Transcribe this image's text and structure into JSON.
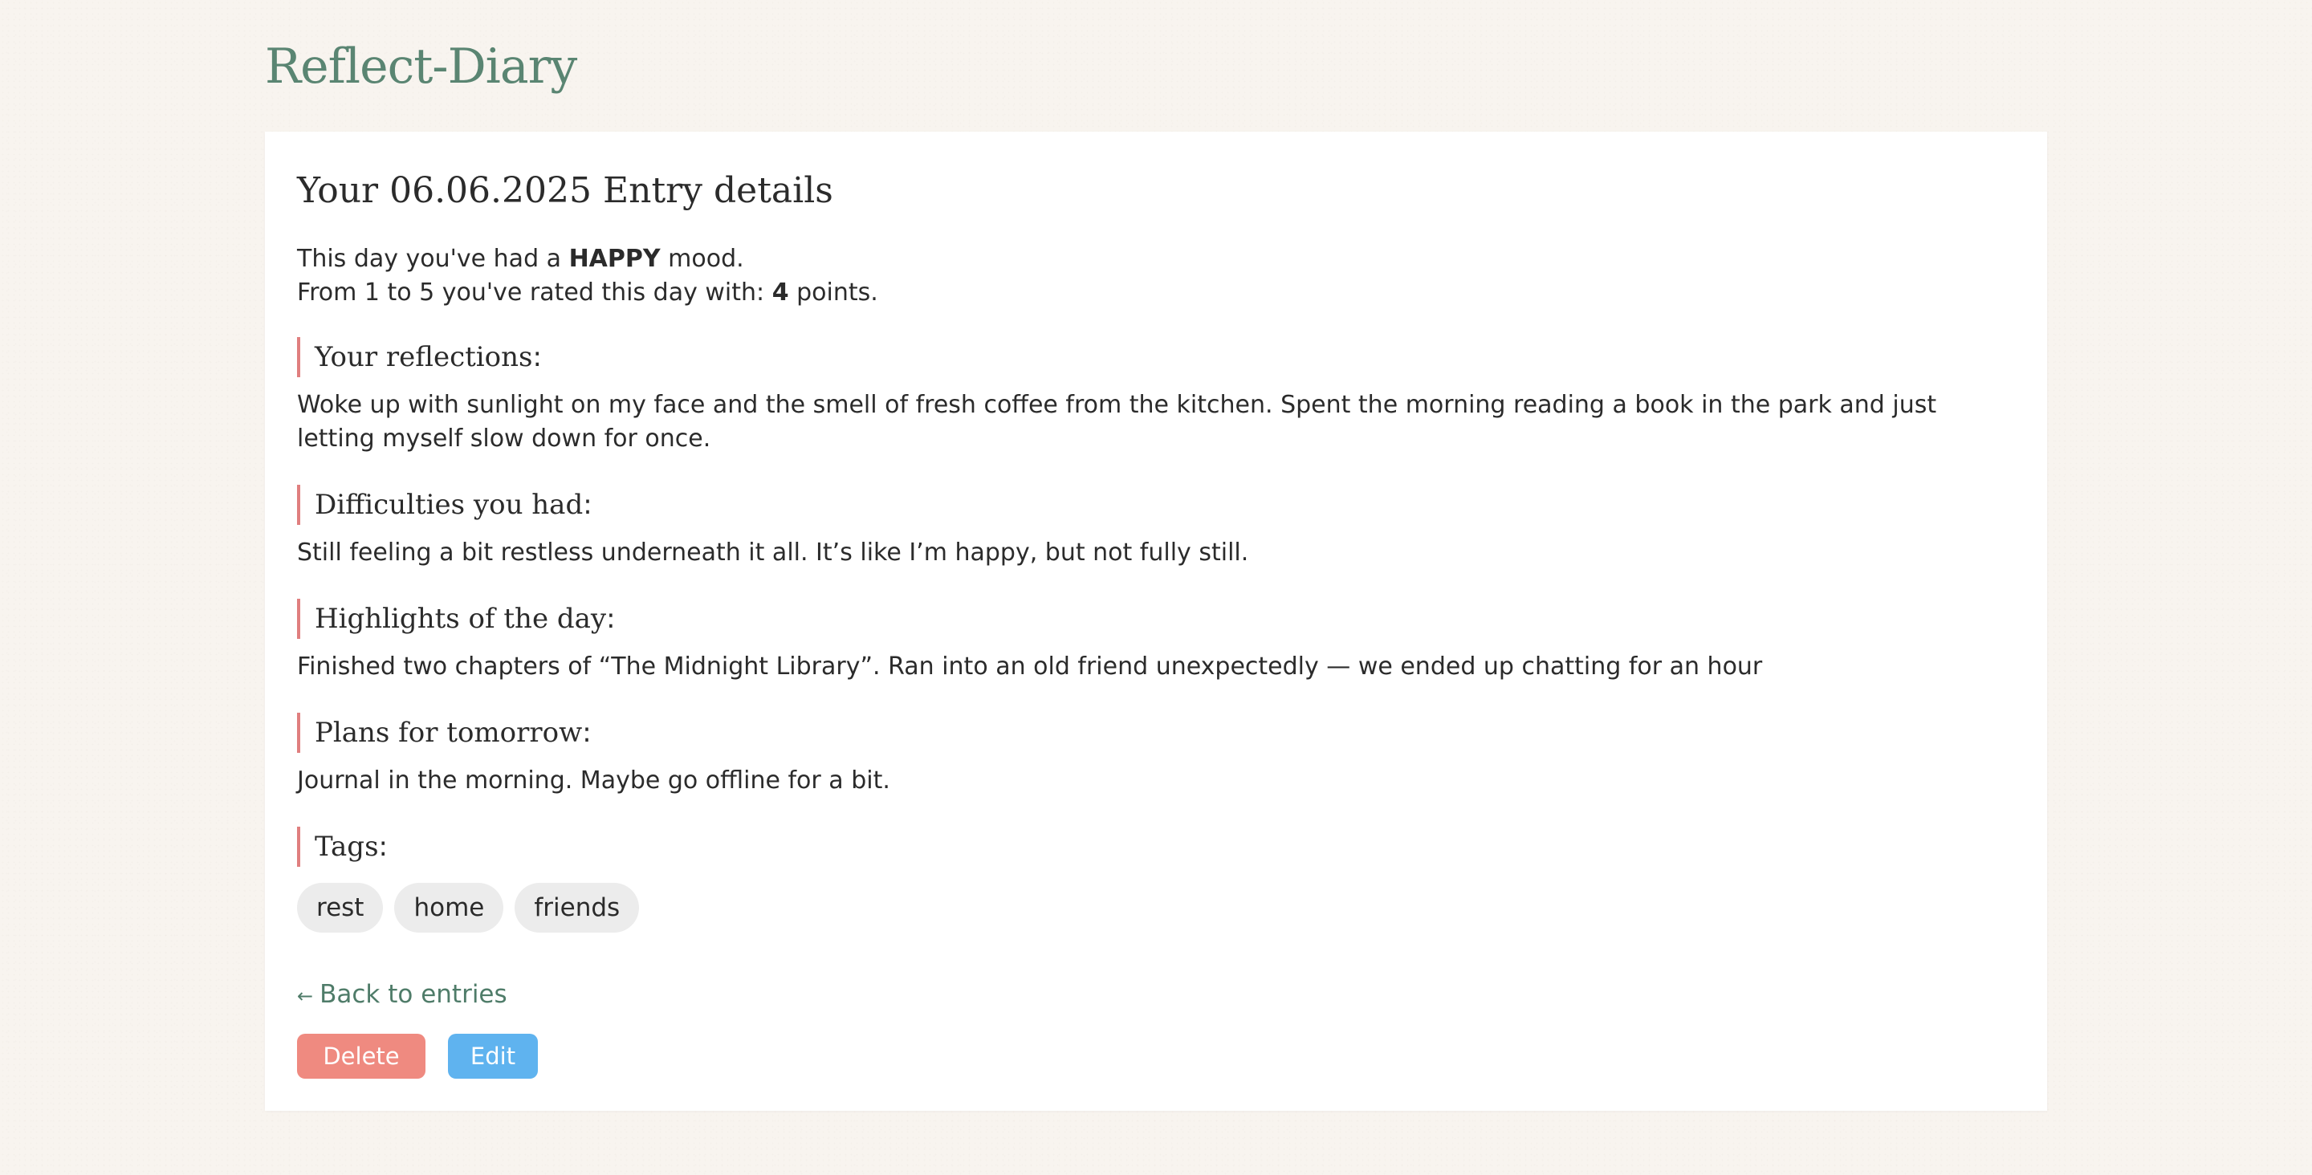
{
  "app": {
    "title": "Reflect-Diary"
  },
  "entry": {
    "title_prefix": "Your ",
    "date": "06.06.2025",
    "title_suffix": " Entry details",
    "mood_prefix": "This day you've had a ",
    "mood": "HAPPY",
    "mood_suffix": " mood.",
    "rating_prefix": "From 1 to 5 you've rated this day with: ",
    "rating": "4",
    "rating_suffix": " points."
  },
  "sections": {
    "reflections": {
      "heading": "Your reflections",
      "text": "Woke up with sunlight on my face and the smell of fresh coffee from the kitchen. Spent the morning reading a book in the park and just letting myself slow down for once."
    },
    "difficulties": {
      "heading": "Difficulties you had",
      "text": "Still feeling a bit restless underneath it all. It’s like I’m happy, but not fully still."
    },
    "highlights": {
      "heading": "Highlights of the day",
      "text": "Finished two chapters of “The Midnight Library”. Ran into an old friend unexpectedly — we ended up chatting for an hour"
    },
    "plans": {
      "heading": "Plans for tomorrow",
      "text": "Journal in the morning. Maybe go offline for a bit."
    },
    "tags": {
      "heading": "Tags",
      "items": [
        "rest",
        "home",
        "friends"
      ]
    },
    "colon": ":"
  },
  "actions": {
    "back_arrow": "←",
    "back_label": "Back to entries",
    "delete_label": "Delete",
    "edit_label": "Edit"
  },
  "colors": {
    "brand": "#5a8572",
    "accent_border": "#e07f7f",
    "delete": "#ef8a80",
    "edit": "#5fb3ef",
    "background": "#f8f4ef",
    "tag_bg": "#ececec"
  },
  "icons": {
    "back": "arrow-left-icon"
  }
}
